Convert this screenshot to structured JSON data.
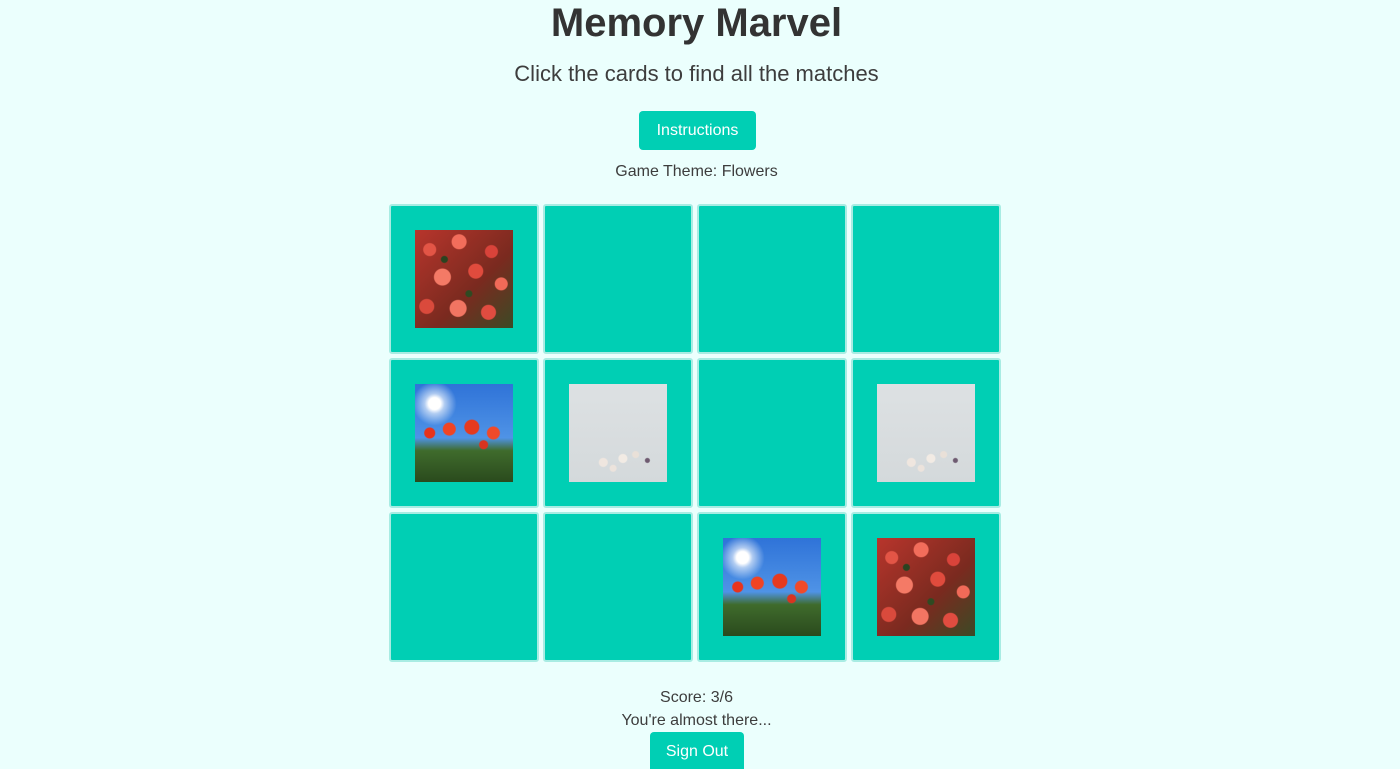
{
  "header": {
    "title": "Memory Marvel",
    "subtitle": "Click the cards to find all the matches"
  },
  "instructions_label": "Instructions",
  "theme_text": "Game Theme: Flowers",
  "board": {
    "cards": [
      {
        "state": "flipped",
        "image": "red-roses"
      },
      {
        "state": "hidden",
        "image": ""
      },
      {
        "state": "hidden",
        "image": ""
      },
      {
        "state": "hidden",
        "image": ""
      },
      {
        "state": "flipped",
        "image": "poppies-sun"
      },
      {
        "state": "flipped",
        "image": "white-flowers"
      },
      {
        "state": "hidden",
        "image": ""
      },
      {
        "state": "flipped",
        "image": "white-flowers"
      },
      {
        "state": "hidden",
        "image": ""
      },
      {
        "state": "hidden",
        "image": ""
      },
      {
        "state": "flipped",
        "image": "poppies-sun"
      },
      {
        "state": "flipped",
        "image": "red-roses"
      }
    ]
  },
  "score_text": "Score: 3/6",
  "message_text": "You're almost there...",
  "signout_label": "Sign Out",
  "colors": {
    "background": "#ebfffd",
    "accent": "#00cfb4",
    "card_border": "#a8ece3"
  }
}
